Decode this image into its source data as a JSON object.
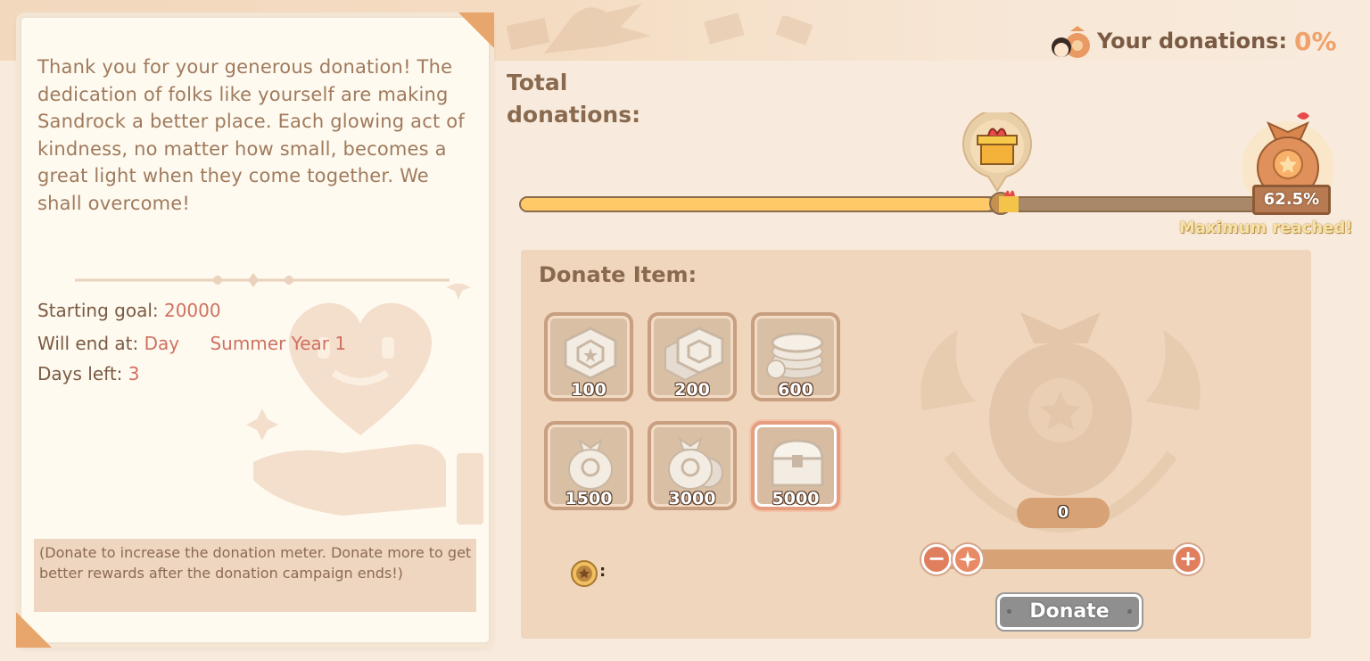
{
  "notice": {
    "message": "Thank you for your generous donation! The dedication of folks like yourself are making Sandrock a better place. Each glowing act of kindness, no matter how small, becomes a great light when they come together. We shall overcome!",
    "starting_goal_label": "Starting goal:",
    "starting_goal_value": "20000",
    "end_label": "Will end at:",
    "end_day": "Day",
    "end_season": "Summer Year 1",
    "days_left_label": "Days left:",
    "days_left_value": "3",
    "footnote": "(Donate to increase the donation meter. Donate more to get better rewards after the donation campaign ends!)"
  },
  "header": {
    "your_donations_label": "Your donations:",
    "your_donations_value": "0%",
    "total_donations_label": "Total donations:"
  },
  "progress": {
    "percent_label": "62.5%",
    "fill_fraction": 0.64,
    "gift_marker_fraction": 0.64,
    "status": "Maximum reached!"
  },
  "donate": {
    "title": "Donate Item:",
    "items": [
      {
        "label": "100",
        "icon": "coin-icon"
      },
      {
        "label": "200",
        "icon": "coins-icon"
      },
      {
        "label": "600",
        "icon": "coin-stack-icon"
      },
      {
        "label": "1500",
        "icon": "money-bag-icon"
      },
      {
        "label": "3000",
        "icon": "money-bags-icon"
      },
      {
        "label": "5000",
        "icon": "treasure-chest-icon"
      }
    ],
    "selected_index": 5,
    "quantity": "0",
    "button_label": "Donate"
  },
  "colors": {
    "accent_orange": "#f0a26a",
    "value_red": "#d07060",
    "bar_fill": "#ffc967",
    "panel_bg": "#efd6bd"
  }
}
